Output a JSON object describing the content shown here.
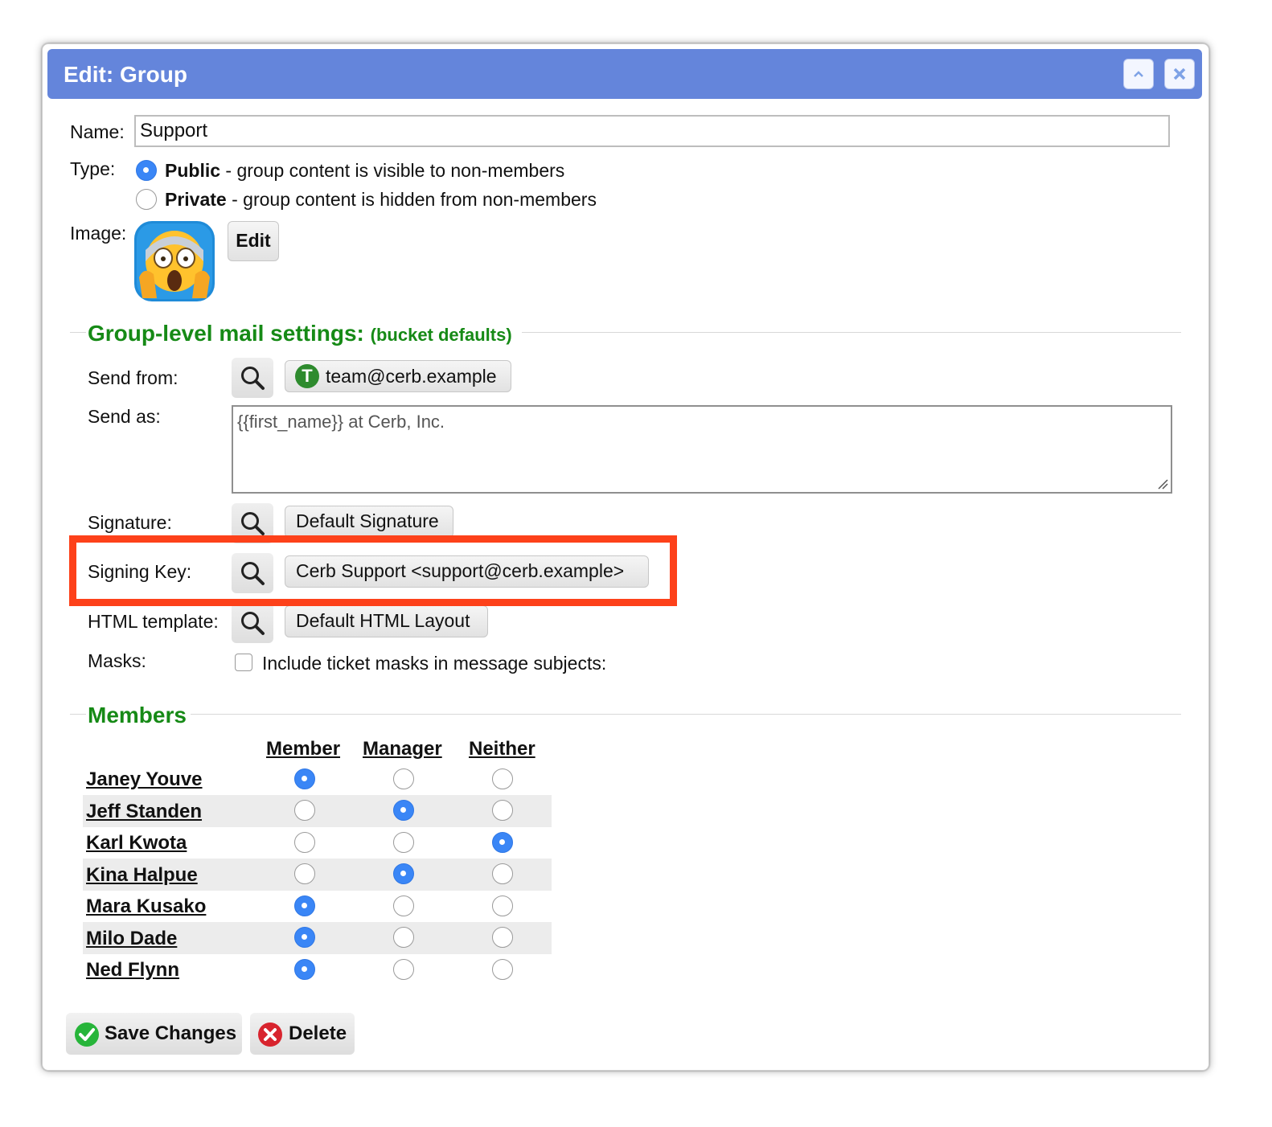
{
  "dialog": {
    "title": "Edit: Group",
    "collapse_icon": "chevron-up-icon",
    "close_icon": "close-icon"
  },
  "form": {
    "name_label": "Name:",
    "name_value": "Support",
    "type_label": "Type:",
    "type_options": [
      {
        "name": "Public",
        "desc": " - group content is visible to non-members",
        "selected": true
      },
      {
        "name": "Private",
        "desc": " - group content is hidden from non-members",
        "selected": false
      }
    ],
    "image_label": "Image:",
    "image_icon": "screaming-face-emoji",
    "image_edit_label": "Edit"
  },
  "mail_settings": {
    "heading": "Group-level mail settings:",
    "heading_note": "(bucket defaults)",
    "send_from_label": "Send from:",
    "send_from_badge_letter": "T",
    "send_from_value": "team@cerb.example",
    "send_as_label": "Send as:",
    "send_as_value": "{{first_name}} at Cerb, Inc.",
    "signature_label": "Signature:",
    "signature_value": "Default Signature",
    "signing_key_label": "Signing Key:",
    "signing_key_value": "Cerb Support <support@cerb.example>",
    "html_template_label": "HTML template:",
    "html_template_value": "Default HTML Layout",
    "masks_label": "Masks:",
    "masks_checkbox_label": "Include ticket masks in message subjects:",
    "masks_checked": false,
    "highlight_color": "#fd411a"
  },
  "members": {
    "heading": "Members",
    "columns": [
      "Member",
      "Manager",
      "Neither"
    ],
    "rows": [
      {
        "name": "Janey Youve",
        "role": "Member"
      },
      {
        "name": "Jeff Standen",
        "role": "Manager"
      },
      {
        "name": "Karl Kwota",
        "role": "Neither"
      },
      {
        "name": "Kina Halpue",
        "role": "Manager"
      },
      {
        "name": "Mara Kusako",
        "role": "Member"
      },
      {
        "name": "Milo Dade",
        "role": "Member"
      },
      {
        "name": "Ned Flynn",
        "role": "Member"
      }
    ]
  },
  "footer": {
    "save_label": "Save Changes",
    "delete_label": "Delete"
  },
  "colors": {
    "titlebar": "#6485db",
    "section_heading": "#168a16",
    "radio_selected": "#3a86f6"
  }
}
